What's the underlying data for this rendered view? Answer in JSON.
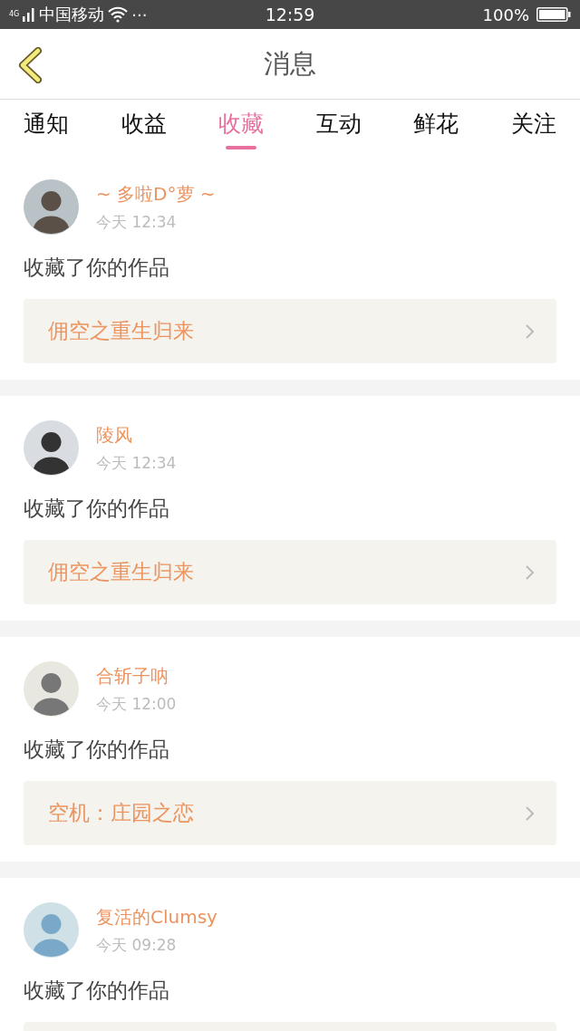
{
  "status_bar": {
    "network": "4G",
    "carrier": "中国移动",
    "more": "···",
    "time": "12:59",
    "battery": "100%"
  },
  "header": {
    "title": "消息"
  },
  "tabs": [
    {
      "label": "通知",
      "selected": false
    },
    {
      "label": "收益",
      "selected": false
    },
    {
      "label": "收藏",
      "selected": true
    },
    {
      "label": "互动",
      "selected": false
    },
    {
      "label": "鲜花",
      "selected": false
    },
    {
      "label": "关注",
      "selected": false
    }
  ],
  "messages": [
    {
      "name": "~ 多啦D°萝 ~",
      "time": "今天 12:34",
      "action": "收藏了你的作品",
      "work": "佣空之重生归来"
    },
    {
      "name": "陵风",
      "time": "今天 12:34",
      "action": "收藏了你的作品",
      "work": "佣空之重生归来"
    },
    {
      "name": "合斩子呐",
      "time": "今天 12:00",
      "action": "收藏了你的作品",
      "work": "空机：庄园之恋"
    },
    {
      "name": "复活的Clumsy",
      "time": "今天 09:28",
      "action": "收藏了你的作品"
    }
  ]
}
